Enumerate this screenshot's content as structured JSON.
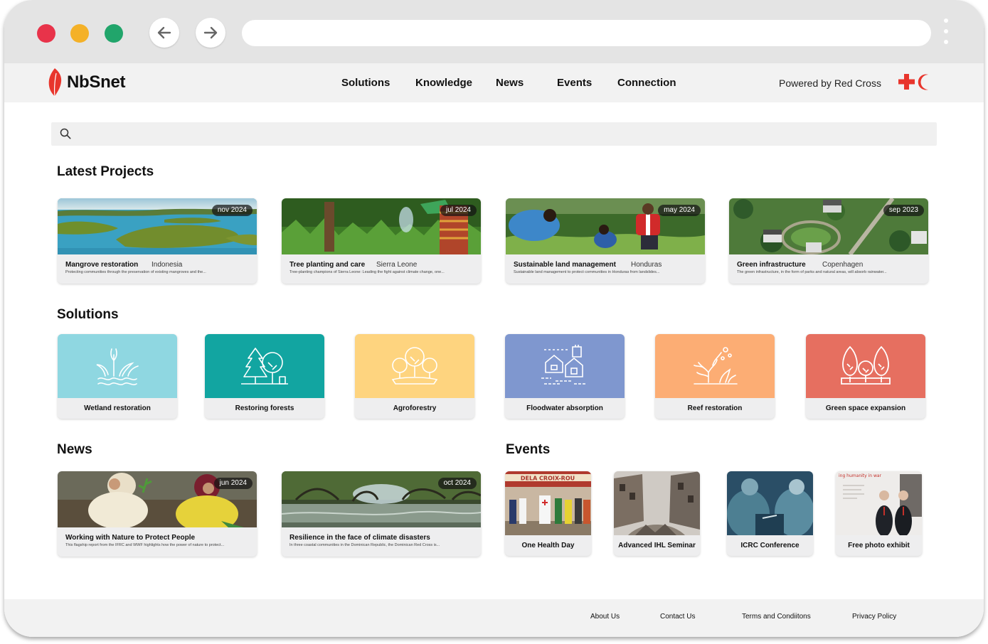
{
  "site": {
    "name": "NbSnet",
    "powered_by": "Powered by Red Cross"
  },
  "nav": [
    "Solutions",
    "Knowledge",
    "News",
    "Events",
    "Connection"
  ],
  "search": {
    "placeholder": ""
  },
  "sections": {
    "projects": "Latest Projects",
    "solutions": "Solutions",
    "news": "News",
    "events": "Events"
  },
  "projects": [
    {
      "title": "Mangrove restoration",
      "location": "Indonesia",
      "date": "nov 2024",
      "desc": "Protecting communities through the preservation of existing mangroves and the..."
    },
    {
      "title": "Tree planting and care",
      "location": "Sierra Leone",
      "date": "jul 2024",
      "desc": "Tree-planting champions of Sierra Leone: Leading the fight against climate change, one..."
    },
    {
      "title": "Sustainable land management",
      "location": "Honduras",
      "date": "may 2024",
      "desc": "Sustainable land management to protect communities in Honduras from landslides..."
    },
    {
      "title": "Green infrastructure",
      "location": "Copenhagen",
      "date": "sep 2023",
      "desc": "The green infrastructure, in the form of parks and natural areas, will absorb rainwater..."
    }
  ],
  "solutions": [
    {
      "label": "Wetland restoration",
      "color": "#8fd7e1",
      "icon": "wetland-icon"
    },
    {
      "label": "Restoring forests",
      "color": "#12a5a1",
      "icon": "forest-icon"
    },
    {
      "label": "Agroforestry",
      "color": "#fed47f",
      "icon": "agroforestry-icon"
    },
    {
      "label": "Floodwater absorption",
      "color": "#7f97cf",
      "icon": "floodwater-icon"
    },
    {
      "label": "Reef restoration",
      "color": "#fcad74",
      "icon": "reef-icon"
    },
    {
      "label": "Green space expansion",
      "color": "#e66f60",
      "icon": "green-space-icon"
    }
  ],
  "news": [
    {
      "title": "Working with Nature to Protect People",
      "date": "jun 2024",
      "desc": "This flagship report from the IFRC and WWF highlights how the power of nature to protect..."
    },
    {
      "title": "Resilience in the face of climate disasters",
      "date": "oct 2024",
      "desc": "In three coastal communities in the Dominican Republic, the Dominican Red Cross is..."
    }
  ],
  "events": [
    {
      "label": "One Health Day",
      "sign": "DELA CROIX-ROU"
    },
    {
      "label": "Advanced IHL Seminar"
    },
    {
      "label": "ICRC Conference"
    },
    {
      "label": "Free photo exhibit",
      "sign": "ing humanity in war"
    }
  ],
  "footer": [
    "About Us",
    "Contact Us",
    "Terms and Condiitons",
    "Privacy Policy"
  ],
  "colors": {
    "brand_red": "#e8352c",
    "chrome": "#e4e4e4"
  }
}
